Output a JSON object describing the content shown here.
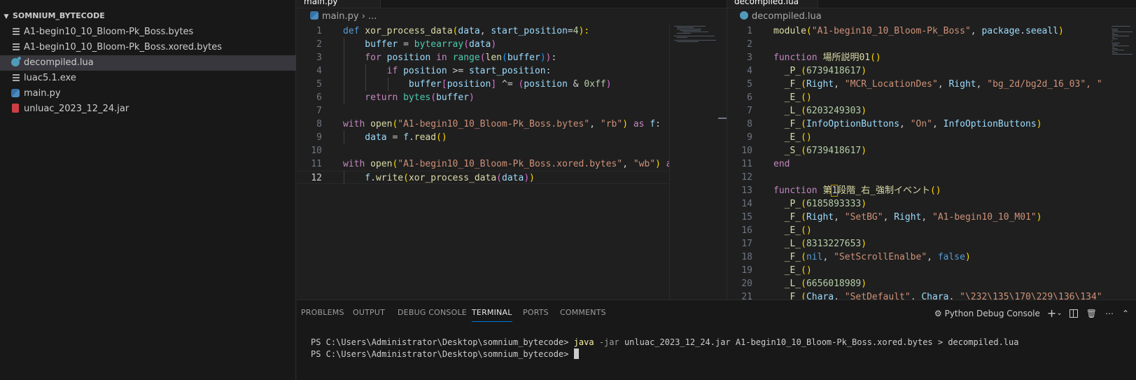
{
  "explorer": {
    "title": "SOMNIUM_BYTECODE",
    "files": [
      {
        "name": "A1-begin10_10_Bloom-Pk_Boss.bytes",
        "icon": "lines-file-icon",
        "selected": false
      },
      {
        "name": "A1-begin10_10_Bloom-Pk_Boss.xored.bytes",
        "icon": "lines-file-icon",
        "selected": false
      },
      {
        "name": "decompiled.lua",
        "icon": "lua-file-icon",
        "selected": true
      },
      {
        "name": "luac5.1.exe",
        "icon": "lines-file-icon",
        "selected": false
      },
      {
        "name": "main.py",
        "icon": "python-file-icon",
        "selected": false
      },
      {
        "name": "unluac_2023_12_24.jar",
        "icon": "jar-file-icon",
        "selected": false
      }
    ]
  },
  "left_editor": {
    "tab_label": "main.py",
    "breadcrumb": {
      "file": "main.py",
      "rest": "› ..."
    },
    "active_line": 12,
    "lines": [
      [
        [
          "def ",
          "k"
        ],
        [
          "xor_process_data",
          "f"
        ],
        [
          "(",
          "br1"
        ],
        [
          "data",
          "v"
        ],
        [
          ", ",
          "p"
        ],
        [
          "start_position",
          "v"
        ],
        [
          "=",
          "p"
        ],
        [
          "4",
          "n"
        ],
        [
          "):",
          "br1"
        ]
      ],
      [
        [
          "    buffer",
          "v"
        ],
        [
          " = ",
          "p"
        ],
        [
          "bytearray",
          "b"
        ],
        [
          "(",
          "br2"
        ],
        [
          "data",
          "v"
        ],
        [
          ")",
          "br2"
        ]
      ],
      [
        [
          "    for ",
          "kc"
        ],
        [
          "position",
          "v"
        ],
        [
          " in ",
          "kc"
        ],
        [
          "range",
          "b"
        ],
        [
          "(",
          "br2"
        ],
        [
          "len",
          "f"
        ],
        [
          "(",
          "br3"
        ],
        [
          "buffer",
          "v"
        ],
        [
          ")",
          "br3"
        ],
        [
          ")",
          "br2"
        ],
        [
          ":",
          "p"
        ]
      ],
      [
        [
          "        if ",
          "kc"
        ],
        [
          "position",
          "v"
        ],
        [
          " >= ",
          "p"
        ],
        [
          "start_position",
          "v"
        ],
        [
          ":",
          "p"
        ]
      ],
      [
        [
          "            buffer",
          "v"
        ],
        [
          "[",
          "br2"
        ],
        [
          "position",
          "v"
        ],
        [
          "]",
          "br2"
        ],
        [
          " ^= ",
          "p"
        ],
        [
          "(",
          "br2"
        ],
        [
          "position",
          "v"
        ],
        [
          " & ",
          "p"
        ],
        [
          "0xff",
          "n"
        ],
        [
          ")",
          "br2"
        ]
      ],
      [
        [
          "    return ",
          "kc"
        ],
        [
          "bytes",
          "b"
        ],
        [
          "(",
          "br2"
        ],
        [
          "buffer",
          "v"
        ],
        [
          ")",
          "br2"
        ]
      ],
      [],
      [
        [
          "with ",
          "kc"
        ],
        [
          "open",
          "f"
        ],
        [
          "(",
          "br1"
        ],
        [
          "\"A1-begin10_10_Bloom-Pk_Boss.bytes\"",
          "s"
        ],
        [
          ", ",
          "p"
        ],
        [
          "\"rb\"",
          "s"
        ],
        [
          ")",
          "br1"
        ],
        [
          " as ",
          "kc"
        ],
        [
          "f",
          "v"
        ],
        [
          ":",
          "p"
        ]
      ],
      [
        [
          "    data",
          "v"
        ],
        [
          " = ",
          "p"
        ],
        [
          "f",
          "v"
        ],
        [
          ".",
          "p"
        ],
        [
          "read",
          "f"
        ],
        [
          "()",
          "br1"
        ]
      ],
      [],
      [
        [
          "with ",
          "kc"
        ],
        [
          "open",
          "f"
        ],
        [
          "(",
          "br1"
        ],
        [
          "\"A1-begin10_10_Bloom-Pk_Boss.xored.bytes\"",
          "s"
        ],
        [
          ", ",
          "p"
        ],
        [
          "\"wb\"",
          "s"
        ],
        [
          ")",
          "br1"
        ],
        [
          " as",
          "kc"
        ]
      ],
      [
        [
          "    f",
          "v"
        ],
        [
          ".",
          "p"
        ],
        [
          "write",
          "f"
        ],
        [
          "(",
          "br1"
        ],
        [
          "xor_process_data",
          "f"
        ],
        [
          "(",
          "br2"
        ],
        [
          "data",
          "v"
        ],
        [
          ")",
          "br2"
        ],
        [
          ")",
          "br1"
        ]
      ]
    ]
  },
  "right_editor": {
    "tab_label": "decompiled.lua",
    "breadcrumb": {
      "file": "decompiled.lua"
    },
    "lines": [
      [
        [
          "module",
          "f"
        ],
        [
          "(",
          "br1"
        ],
        [
          "\"A1-begin10_10_Bloom-Pk_Boss\"",
          "s"
        ],
        [
          ", ",
          "p"
        ],
        [
          "package",
          "v"
        ],
        [
          ".",
          "p"
        ],
        [
          "seeall",
          "v"
        ],
        [
          ")",
          "br1"
        ]
      ],
      [],
      [
        [
          "function ",
          "kc"
        ],
        [
          "場所説明01",
          "f"
        ],
        [
          "()",
          "br1"
        ]
      ],
      [
        [
          "  _P_",
          "f"
        ],
        [
          "(",
          "br1"
        ],
        [
          "6739418617",
          "n"
        ],
        [
          ")",
          "br1"
        ]
      ],
      [
        [
          "  _F_",
          "f"
        ],
        [
          "(",
          "br1"
        ],
        [
          "Right",
          "v"
        ],
        [
          ", ",
          "p"
        ],
        [
          "\"MCR_LocationDes\"",
          "s"
        ],
        [
          ", ",
          "p"
        ],
        [
          "Right",
          "v"
        ],
        [
          ", ",
          "p"
        ],
        [
          "\"bg_2d/bg2d_16_03\"",
          "s"
        ],
        [
          ", \"",
          "s"
        ]
      ],
      [
        [
          "  _E_",
          "f"
        ],
        [
          "()",
          "br1"
        ]
      ],
      [
        [
          "  _L_",
          "f"
        ],
        [
          "(",
          "br1"
        ],
        [
          "6203249303",
          "n"
        ],
        [
          ")",
          "br1"
        ]
      ],
      [
        [
          "  _F_",
          "f"
        ],
        [
          "(",
          "br1"
        ],
        [
          "InfoOptionButtons",
          "v"
        ],
        [
          ", ",
          "p"
        ],
        [
          "\"On\"",
          "s"
        ],
        [
          ", ",
          "p"
        ],
        [
          "InfoOptionButtons",
          "v"
        ],
        [
          ")",
          "br1"
        ]
      ],
      [
        [
          "  _E_",
          "f"
        ],
        [
          "()",
          "br1"
        ]
      ],
      [
        [
          "  _S_",
          "f"
        ],
        [
          "(",
          "br1"
        ],
        [
          "6739418617",
          "n"
        ],
        [
          ")",
          "br1"
        ]
      ],
      [
        [
          "end",
          "kc"
        ]
      ],
      [],
      [
        [
          "function ",
          "kc"
        ],
        [
          "第",
          "f"
        ],
        [
          "1",
          "hl"
        ],
        [
          "段階_右_強制イベント",
          "f"
        ],
        [
          "()",
          "br1"
        ]
      ],
      [
        [
          "  _P_",
          "f"
        ],
        [
          "(",
          "br1"
        ],
        [
          "6185893333",
          "n"
        ],
        [
          ")",
          "br1"
        ]
      ],
      [
        [
          "  _F_",
          "f"
        ],
        [
          "(",
          "br1"
        ],
        [
          "Right",
          "v"
        ],
        [
          ", ",
          "p"
        ],
        [
          "\"SetBG\"",
          "s"
        ],
        [
          ", ",
          "p"
        ],
        [
          "Right",
          "v"
        ],
        [
          ", ",
          "p"
        ],
        [
          "\"A1-begin10_10_M01\"",
          "s"
        ],
        [
          ")",
          "br1"
        ]
      ],
      [
        [
          "  _E_",
          "f"
        ],
        [
          "()",
          "br1"
        ]
      ],
      [
        [
          "  _L_",
          "f"
        ],
        [
          "(",
          "br1"
        ],
        [
          "8313227653",
          "n"
        ],
        [
          ")",
          "br1"
        ]
      ],
      [
        [
          "  _F_",
          "f"
        ],
        [
          "(",
          "br1"
        ],
        [
          "nil",
          "k"
        ],
        [
          ", ",
          "p"
        ],
        [
          "\"SetScrollEnalbe\"",
          "s"
        ],
        [
          ", ",
          "p"
        ],
        [
          "false",
          "k"
        ],
        [
          ")",
          "br1"
        ]
      ],
      [
        [
          "  _E_",
          "f"
        ],
        [
          "()",
          "br1"
        ]
      ],
      [
        [
          "  _L_",
          "f"
        ],
        [
          "(",
          "br1"
        ],
        [
          "6656018989",
          "n"
        ],
        [
          ")",
          "br1"
        ]
      ],
      [
        [
          "  _F_",
          "f"
        ],
        [
          "(",
          "br1"
        ],
        [
          "Chara",
          "v"
        ],
        [
          ", ",
          "p"
        ],
        [
          "\"SetDefault\"",
          "s"
        ],
        [
          ", ",
          "p"
        ],
        [
          "Chara",
          "v"
        ],
        [
          ", ",
          "p"
        ],
        [
          "\"\\232\\135\\170\\229\\136\\134\"",
          "s"
        ]
      ]
    ]
  },
  "panel": {
    "tabs": [
      "PROBLEMS",
      "OUTPUT",
      "DEBUG CONSOLE",
      "TERMINAL",
      "PORTS",
      "COMMENTS"
    ],
    "active_tab": "TERMINAL",
    "terminal_name": "Python Debug Console",
    "terminal": {
      "prompt1": "PS C:\\Users\\Administrator\\Desktop\\somnium_bytecode> ",
      "cmd": "java",
      "flag": " -jar",
      "args": " unluac_2023_12_24.jar A1-begin10_10_Bloom-Pk_Boss.xored.bytes > decompiled.lua",
      "prompt2": "PS C:\\Users\\Administrator\\Desktop\\somnium_bytecode> "
    }
  }
}
